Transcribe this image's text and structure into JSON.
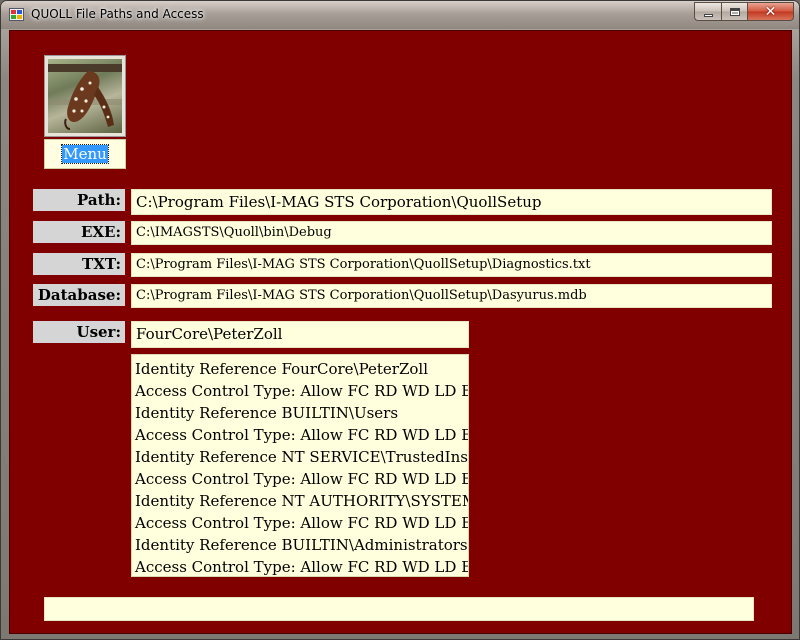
{
  "window": {
    "title": "QUOLL File Paths and Access",
    "minimize_icon": "minimize-icon",
    "maximize_icon": "maximize-icon",
    "close_icon": "close-icon"
  },
  "colors": {
    "client_background": "#800000",
    "field_background": "#ffffdd",
    "label_background": "#d5d5d5",
    "selection": "#3399ff"
  },
  "logo": {
    "icon": "quoll-photo"
  },
  "menu": {
    "label": "Menu"
  },
  "fields": {
    "path": {
      "label": "Path:",
      "value": "C:\\Program Files\\I-MAG STS Corporation\\QuollSetup"
    },
    "exe": {
      "label": "EXE:",
      "value": "C:\\IMAGSTS\\Quoll\\bin\\Debug"
    },
    "txt": {
      "label": "TXT:",
      "value": "C:\\Program Files\\I-MAG STS Corporation\\QuollSetup\\Diagnostics.txt"
    },
    "database": {
      "label": "Database:",
      "value": "C:\\Program Files\\I-MAG STS Corporation\\QuollSetup\\Dasyurus.mdb"
    },
    "user": {
      "label": "User:",
      "value": "FourCore\\PeterZoll"
    }
  },
  "access_list": [
    "Identity Reference FourCore\\PeterZoll",
    "Access Control Type: Allow FC RD WD LD EF",
    "Identity Reference BUILTIN\\Users",
    "Access Control Type: Allow FC RD WD LD EF",
    "Identity Reference NT SERVICE\\TrustedInstaller",
    "Access Control Type: Allow FC RD WD LD EF",
    "Identity Reference NT AUTHORITY\\SYSTEM",
    "Access Control Type: Allow FC RD WD LD EF",
    "Identity Reference BUILTIN\\Administrators",
    "Access Control Type: Allow FC RD WD LD EF"
  ],
  "status": {
    "text": ""
  }
}
